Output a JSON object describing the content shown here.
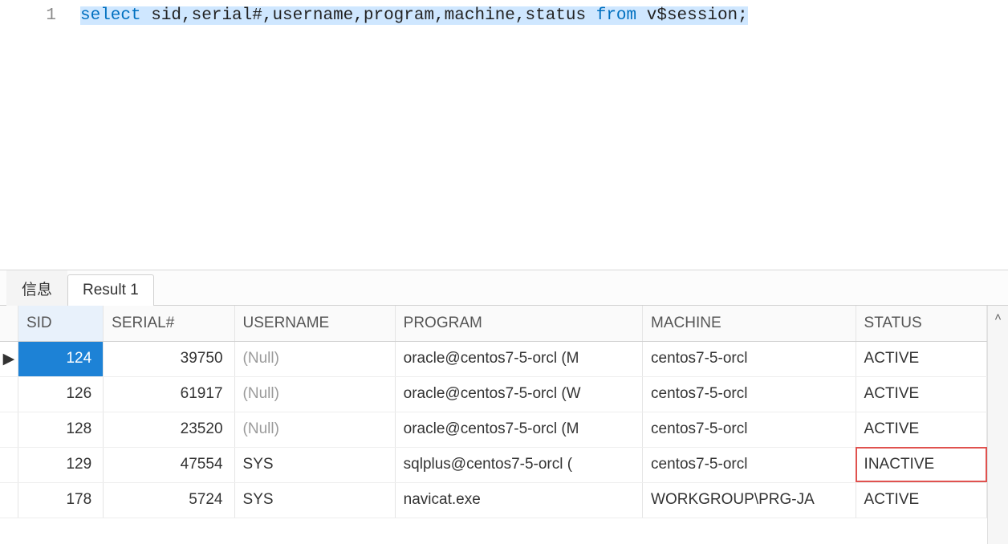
{
  "editor": {
    "line_number": "1",
    "sql_tokens": [
      {
        "t": "select",
        "cls": "kw"
      },
      {
        "t": " sid,serial#,username,program,machine,status ",
        "cls": "txt"
      },
      {
        "t": "from",
        "cls": "kw"
      },
      {
        "t": " v$session;",
        "cls": "txt"
      }
    ],
    "selected": true
  },
  "tabs": [
    {
      "label": "信息",
      "active": false
    },
    {
      "label": "Result 1",
      "active": true
    }
  ],
  "results": {
    "columns": [
      {
        "label": "SID",
        "width_class": "c-sid",
        "align": "num",
        "sorted": true
      },
      {
        "label": "SERIAL#",
        "width_class": "c-serial",
        "align": "num",
        "sorted": false
      },
      {
        "label": "USERNAME",
        "width_class": "c-user",
        "align": "text",
        "sorted": false
      },
      {
        "label": "PROGRAM",
        "width_class": "c-prog",
        "align": "text",
        "sorted": false
      },
      {
        "label": "MACHINE",
        "width_class": "c-mach",
        "align": "text",
        "sorted": false
      },
      {
        "label": "STATUS",
        "width_class": "c-stat",
        "align": "text",
        "sorted": false
      }
    ],
    "rows": [
      {
        "marker": "▶",
        "selected": true,
        "cells": {
          "SID": "124",
          "SERIAL#": "39750",
          "USERNAME": "(Null)",
          "PROGRAM": "oracle@centos7-5-orcl (M",
          "MACHINE": "centos7-5-orcl",
          "STATUS": "ACTIVE"
        },
        "null_cols": [
          "USERNAME"
        ],
        "highlight_cols": []
      },
      {
        "marker": "",
        "selected": false,
        "cells": {
          "SID": "126",
          "SERIAL#": "61917",
          "USERNAME": "(Null)",
          "PROGRAM": "oracle@centos7-5-orcl (W",
          "MACHINE": "centos7-5-orcl",
          "STATUS": "ACTIVE"
        },
        "null_cols": [
          "USERNAME"
        ],
        "highlight_cols": []
      },
      {
        "marker": "",
        "selected": false,
        "cells": {
          "SID": "128",
          "SERIAL#": "23520",
          "USERNAME": "(Null)",
          "PROGRAM": "oracle@centos7-5-orcl (M",
          "MACHINE": "centos7-5-orcl",
          "STATUS": "ACTIVE"
        },
        "null_cols": [
          "USERNAME"
        ],
        "highlight_cols": []
      },
      {
        "marker": "",
        "selected": false,
        "cells": {
          "SID": "129",
          "SERIAL#": "47554",
          "USERNAME": "SYS",
          "PROGRAM": "sqlplus@centos7-5-orcl (",
          "MACHINE": "centos7-5-orcl",
          "STATUS": "INACTIVE"
        },
        "null_cols": [],
        "highlight_cols": [
          "STATUS"
        ]
      },
      {
        "marker": "",
        "selected": false,
        "cells": {
          "SID": "178",
          "SERIAL#": "5724",
          "USERNAME": "SYS",
          "PROGRAM": "navicat.exe",
          "MACHINE": "WORKGROUP\\PRG-JA",
          "STATUS": "ACTIVE"
        },
        "null_cols": [],
        "highlight_cols": []
      }
    ]
  },
  "scrollbar": {
    "up_glyph": "˄"
  }
}
